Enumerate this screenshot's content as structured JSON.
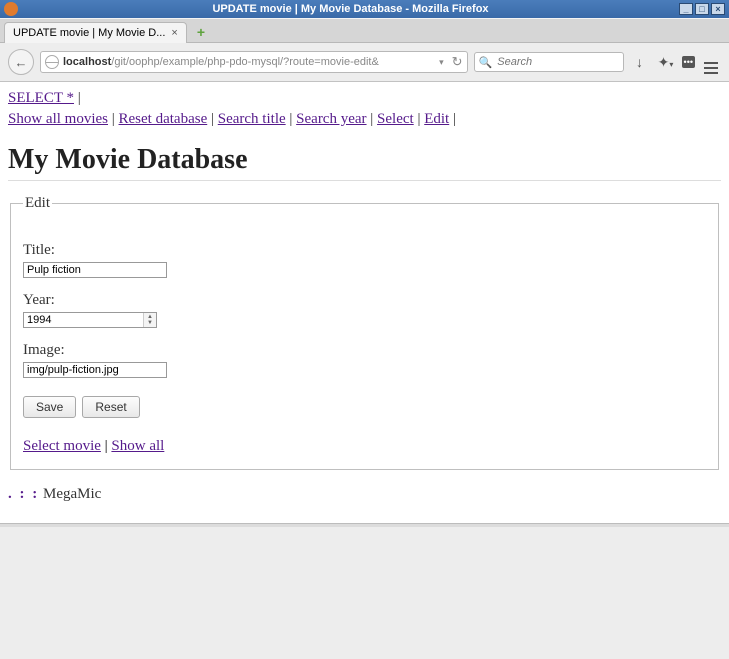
{
  "window": {
    "title": "UPDATE movie | My Movie Database - Mozilla Firefox"
  },
  "tab": {
    "label": "UPDATE movie | My Movie D..."
  },
  "urlbar": {
    "host": "localhost",
    "path": "/git/oophp/example/php-pdo-mysql/?route=movie-edit&"
  },
  "searchbox": {
    "placeholder": "Search"
  },
  "navlinks": {
    "row1_a": "SELECT *",
    "row2": [
      "Show all movies",
      "Reset database",
      "Search title",
      "Search year",
      "Select",
      "Edit"
    ]
  },
  "page": {
    "h1": "My Movie Database"
  },
  "form": {
    "legend": "Edit",
    "title_label": "Title:",
    "title_value": "Pulp fiction",
    "year_label": "Year:",
    "year_value": "1994",
    "image_label": "Image:",
    "image_value": "img/pulp-fiction.jpg",
    "save_label": "Save",
    "reset_label": "Reset",
    "select_movie": "Select movie",
    "show_all": "Show all"
  },
  "footer": {
    "text": "MegaMic"
  }
}
